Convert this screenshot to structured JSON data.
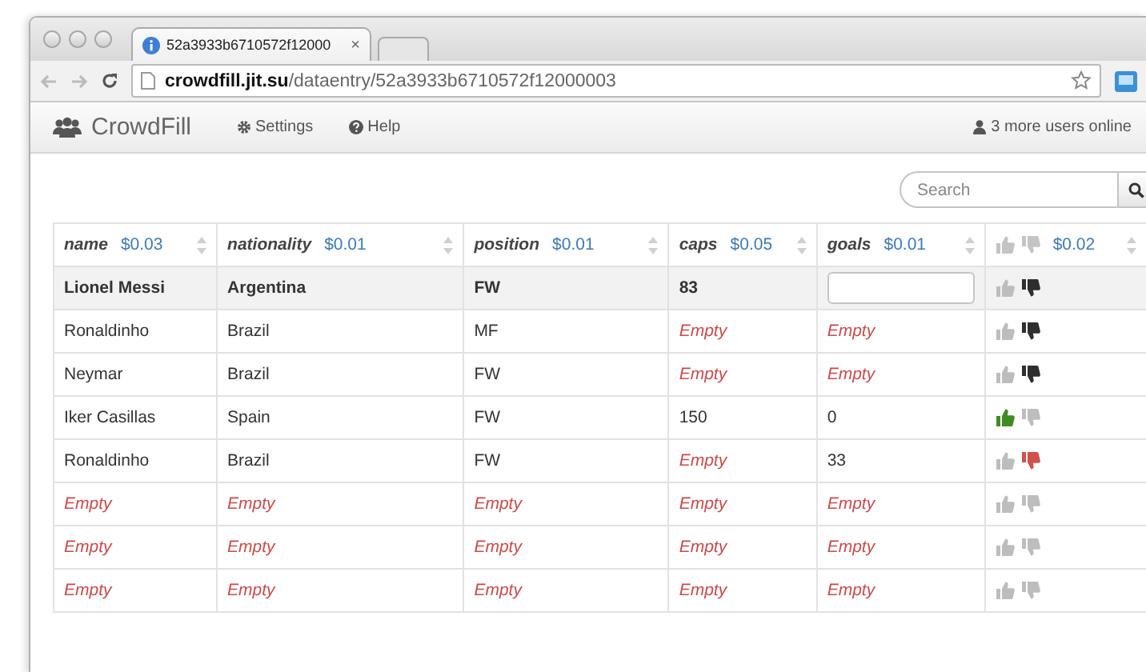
{
  "browser": {
    "tab_title": "52a3933b6710572f12000",
    "tab_close": "×",
    "url_host": "crowdfill.jit.su",
    "url_path": "/dataentry/52a3933b6710572f12000003"
  },
  "navbar": {
    "brand": "CrowdFill",
    "links": [
      "Settings",
      "Help"
    ],
    "online": "3 more users online"
  },
  "search": {
    "placeholder": "Search"
  },
  "table": {
    "columns": [
      {
        "kind": "field",
        "label": "name",
        "price": "$0.03"
      },
      {
        "kind": "field",
        "label": "nationality",
        "price": "$0.01"
      },
      {
        "kind": "field",
        "label": "position",
        "price": "$0.01"
      },
      {
        "kind": "field",
        "label": "caps",
        "price": "$0.05"
      },
      {
        "kind": "field",
        "label": "goals",
        "price": "$0.01"
      },
      {
        "kind": "votes",
        "price": "$0.02"
      }
    ],
    "rows": [
      {
        "selected": true,
        "cells": [
          {
            "kind": "value",
            "text": "Lionel Messi"
          },
          {
            "kind": "value",
            "text": "Argentina"
          },
          {
            "kind": "value",
            "text": "FW"
          },
          {
            "kind": "value",
            "text": "83"
          },
          {
            "kind": "input"
          }
        ],
        "up_active": false,
        "down_active": false,
        "down_dark": true
      },
      {
        "selected": false,
        "cells": [
          {
            "kind": "value",
            "text": "Ronaldinho"
          },
          {
            "kind": "value",
            "text": "Brazil"
          },
          {
            "kind": "value",
            "text": "MF"
          },
          {
            "kind": "empty",
            "text": "Empty"
          },
          {
            "kind": "empty",
            "text": "Empty"
          }
        ],
        "up_active": false,
        "down_active": false,
        "down_dark": true
      },
      {
        "selected": false,
        "cells": [
          {
            "kind": "value",
            "text": "Neymar"
          },
          {
            "kind": "value",
            "text": "Brazil"
          },
          {
            "kind": "value",
            "text": "FW"
          },
          {
            "kind": "empty",
            "text": "Empty"
          },
          {
            "kind": "empty",
            "text": "Empty"
          }
        ],
        "up_active": false,
        "down_active": false,
        "down_dark": true
      },
      {
        "selected": false,
        "cells": [
          {
            "kind": "value",
            "text": "Iker Casillas"
          },
          {
            "kind": "value",
            "text": "Spain"
          },
          {
            "kind": "value",
            "text": "FW"
          },
          {
            "kind": "value",
            "text": "150"
          },
          {
            "kind": "value",
            "text": "0"
          }
        ],
        "up_active": true,
        "down_active": false,
        "down_dark": false
      },
      {
        "selected": false,
        "cells": [
          {
            "kind": "value",
            "text": "Ronaldinho"
          },
          {
            "kind": "value",
            "text": "Brazil"
          },
          {
            "kind": "value",
            "text": "FW"
          },
          {
            "kind": "empty",
            "text": "Empty"
          },
          {
            "kind": "value",
            "text": "33"
          }
        ],
        "up_active": false,
        "down_active": true,
        "down_dark": false
      },
      {
        "selected": false,
        "cells": [
          {
            "kind": "empty",
            "text": "Empty"
          },
          {
            "kind": "empty",
            "text": "Empty"
          },
          {
            "kind": "empty",
            "text": "Empty"
          },
          {
            "kind": "empty",
            "text": "Empty"
          },
          {
            "kind": "empty",
            "text": "Empty"
          }
        ],
        "up_active": false,
        "down_active": false,
        "down_dark": false
      },
      {
        "selected": false,
        "cells": [
          {
            "kind": "empty",
            "text": "Empty"
          },
          {
            "kind": "empty",
            "text": "Empty"
          },
          {
            "kind": "empty",
            "text": "Empty"
          },
          {
            "kind": "empty",
            "text": "Empty"
          },
          {
            "kind": "empty",
            "text": "Empty"
          }
        ],
        "up_active": false,
        "down_active": false,
        "down_dark": false
      },
      {
        "selected": false,
        "cells": [
          {
            "kind": "empty",
            "text": "Empty"
          },
          {
            "kind": "empty",
            "text": "Empty"
          },
          {
            "kind": "empty",
            "text": "Empty"
          },
          {
            "kind": "empty",
            "text": "Empty"
          },
          {
            "kind": "empty",
            "text": "Empty"
          }
        ],
        "up_active": false,
        "down_active": false,
        "down_dark": false
      }
    ]
  }
}
